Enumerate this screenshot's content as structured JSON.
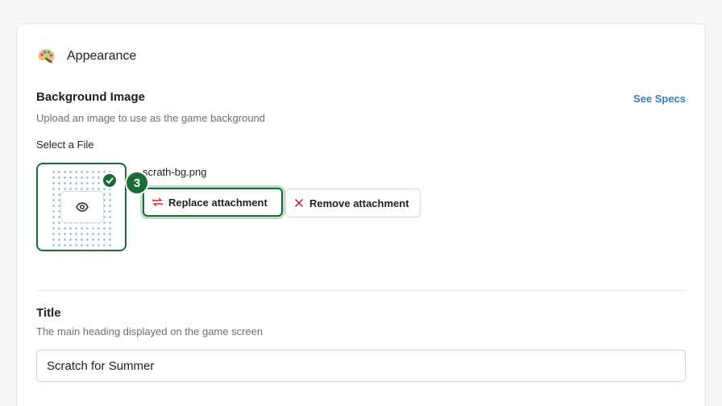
{
  "section": {
    "title": "Appearance",
    "icon": "palette-icon"
  },
  "background_image": {
    "label": "Background Image",
    "help": "Upload an image to use as the game background",
    "see_specs": "See Specs",
    "select_label": "Select a File",
    "file_name": "scrath-bg.png",
    "step_number": "3",
    "replace_label": "Replace attachment",
    "remove_label": "Remove attachment"
  },
  "title_field": {
    "label": "Title",
    "help": "The main heading displayed on the game screen",
    "value": "Scratch for Summer"
  },
  "colors": {
    "accent": "#1b6b3a",
    "link": "#2f7ec1",
    "danger": "#d8262c"
  }
}
